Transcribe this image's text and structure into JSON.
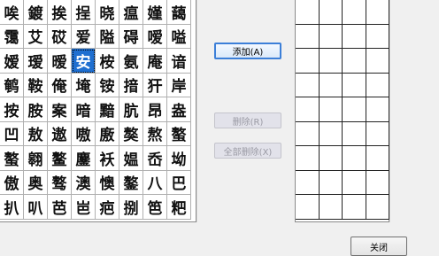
{
  "left_grid": {
    "selected_index": 19,
    "chars": [
      "唉",
      "鍍",
      "挨",
      "挰",
      "晓",
      "瘟",
      "嫤",
      "藹",
      "霭",
      "艾",
      "砹",
      "爱",
      "隘",
      "碍",
      "嗳",
      "嗌",
      "嫒",
      "瑷",
      "暧",
      "安",
      "桉",
      "氨",
      "庵",
      "谙",
      "鹌",
      "鞍",
      "俺",
      "埯",
      "铵",
      "揞",
      "犴",
      "岸",
      "按",
      "胺",
      "案",
      "暗",
      "黯",
      "肮",
      "昂",
      "盎",
      "凹",
      "敖",
      "遨",
      "嗷",
      "廒",
      "獒",
      "熬",
      "螯",
      "螯",
      "翱",
      "鳌",
      "鏖",
      "袄",
      "媪",
      "岙",
      "坳",
      "傲",
      "奥",
      "骜",
      "澳",
      "懊",
      "鏊",
      "八",
      "巴",
      "扒",
      "叭",
      "芭",
      "岜",
      "疤",
      "捌",
      "笆",
      "粑"
    ]
  },
  "right_grid": {
    "columns": 4,
    "rows": 9
  },
  "buttons": {
    "add": "添加(A)",
    "delete": "删除(R)",
    "delete_all": "全部删除(X)",
    "close": "关闭"
  }
}
